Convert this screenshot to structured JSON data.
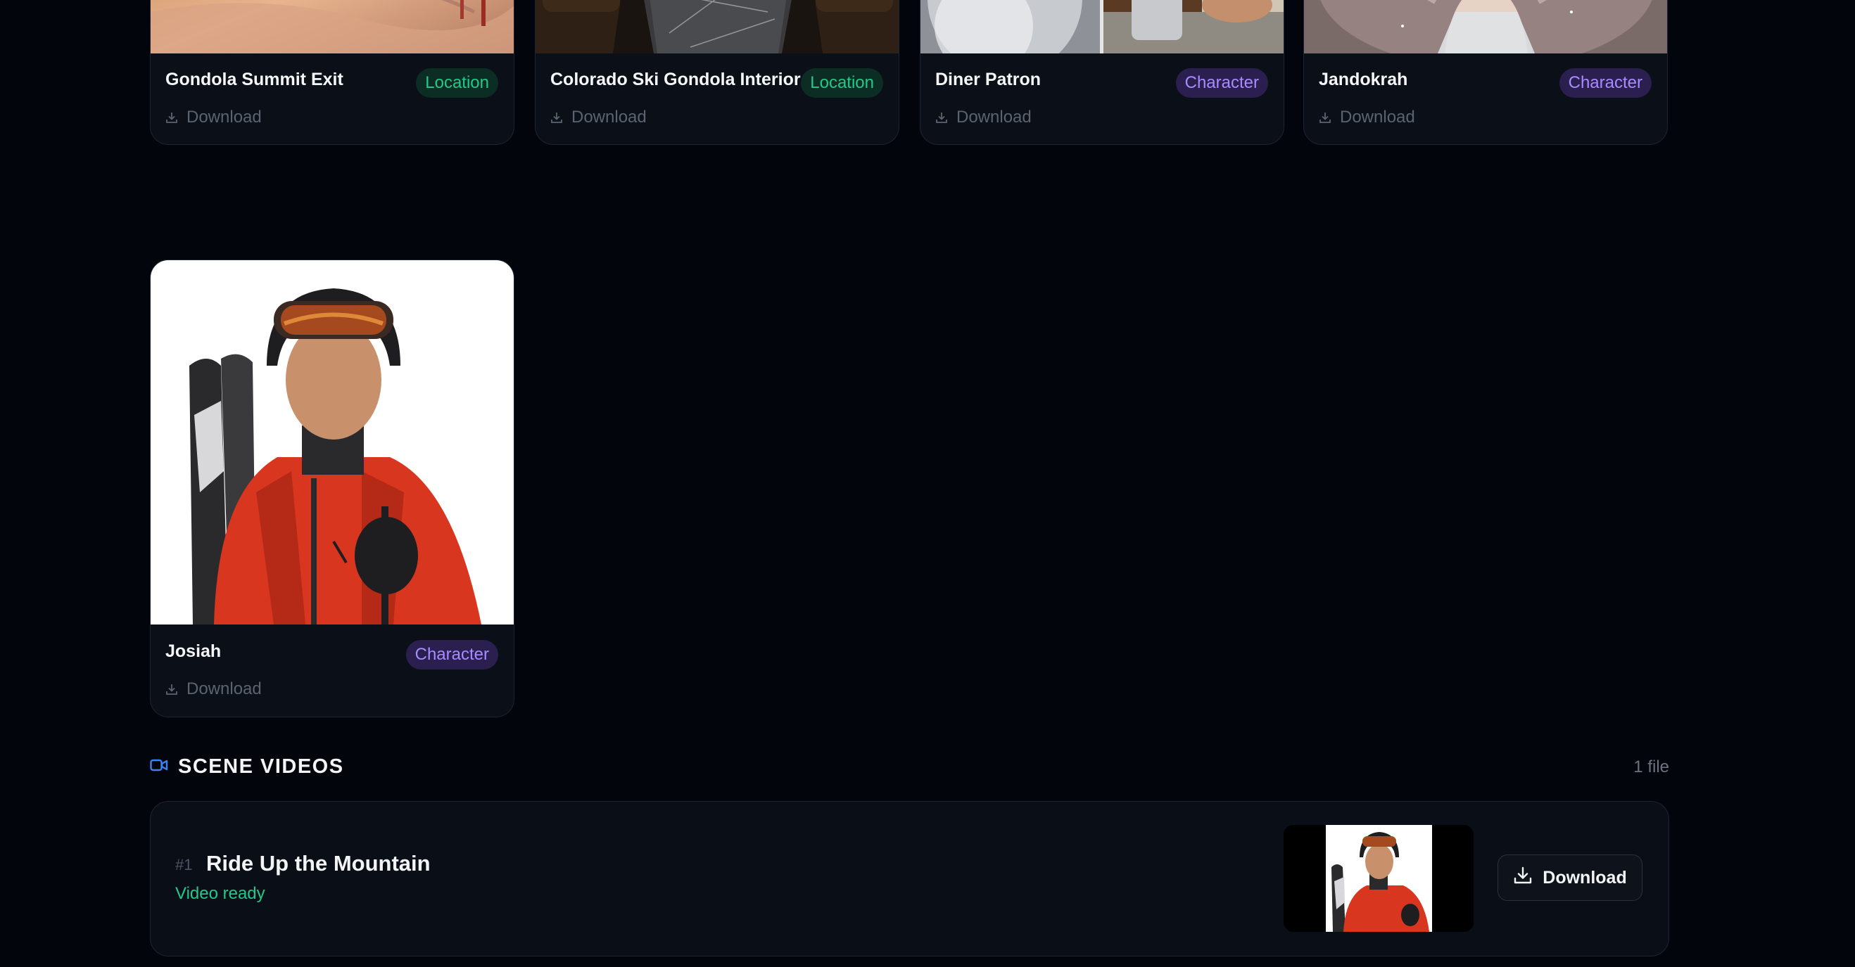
{
  "assets": [
    {
      "title": "Gondola Summit Exit",
      "type": "Location",
      "download_label": "Download"
    },
    {
      "title": "Colorado Ski Gondola Interior",
      "type": "Location",
      "download_label": "Download"
    },
    {
      "title": "Diner Patron",
      "type": "Character",
      "download_label": "Download"
    },
    {
      "title": "Jandokrah",
      "type": "Character",
      "download_label": "Download"
    },
    {
      "title": "Josiah",
      "type": "Character",
      "download_label": "Download"
    }
  ],
  "scene_videos": {
    "title": "SCENE VIDEOS",
    "file_count": "1 file",
    "items": [
      {
        "number": "#1",
        "title": "Ride Up the Mountain",
        "status": "Video ready",
        "download_label": "Download"
      }
    ]
  },
  "colors": {
    "background": "#03050d",
    "card": "#0b0f18",
    "location_badge_text": "#22c98a",
    "character_badge_text": "#a98bff",
    "status_ready": "#22c98a",
    "section_icon": "#3b82f6"
  },
  "icons": {
    "download": "download-icon",
    "section": "video-camera-icon"
  }
}
